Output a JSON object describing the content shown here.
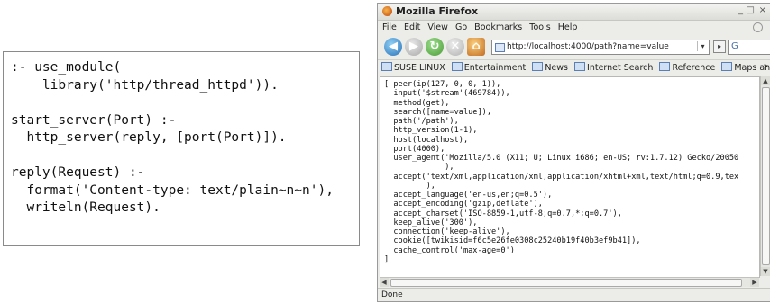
{
  "code_panel": {
    "lines": [
      ":- use_module(",
      "    library('http/thread_httpd')).",
      "",
      "start_server(Port) :-",
      "  http_server(reply, [port(Port)]).",
      "",
      "reply(Request) :-",
      "  format('Content-type: text/plain~n~n'),",
      "  writeln(Request)."
    ]
  },
  "browser": {
    "title": "Mozilla Firefox",
    "window_controls": [
      "_",
      "□",
      "×"
    ],
    "menu": [
      "File",
      "Edit",
      "View",
      "Go",
      "Bookmarks",
      "Tools",
      "Help"
    ],
    "url": "http://localhost:4000/path?name=value",
    "bookmarks": [
      "SUSE LINUX",
      "Entertainment",
      "News",
      "Internet Search",
      "Reference",
      "Maps and Directions"
    ],
    "bookmarks_more": "»",
    "content_lines": [
      "[ peer(ip(127, 0, 0, 1)),",
      "  input('$stream'(469784)),",
      "  method(get),",
      "  search([name=value]),",
      "  path('/path'),",
      "  http_version(1-1),",
      "  host(localhost),",
      "  port(4000),",
      "  user_agent('Mozilla/5.0 (X11; U; Linux i686; en-US; rv:1.7.12) Gecko/20050",
      "             ),",
      "  accept('text/xml,application/xml,application/xhtml+xml,text/html;q=0.9,tex",
      "         ),",
      "  accept_language('en-us,en;q=0.5'),",
      "  accept_encoding('gzip,deflate'),",
      "  accept_charset('ISO-8859-1,utf-8;q=0.7,*;q=0.7'),",
      "  keep_alive('300'),",
      "  connection('keep-alive'),",
      "  cookie([twikisid=f6c5e26fe0308c25240b19f40b3ef9b41]),",
      "  cache_control('max-age=0')",
      "]"
    ],
    "status": "Done"
  }
}
